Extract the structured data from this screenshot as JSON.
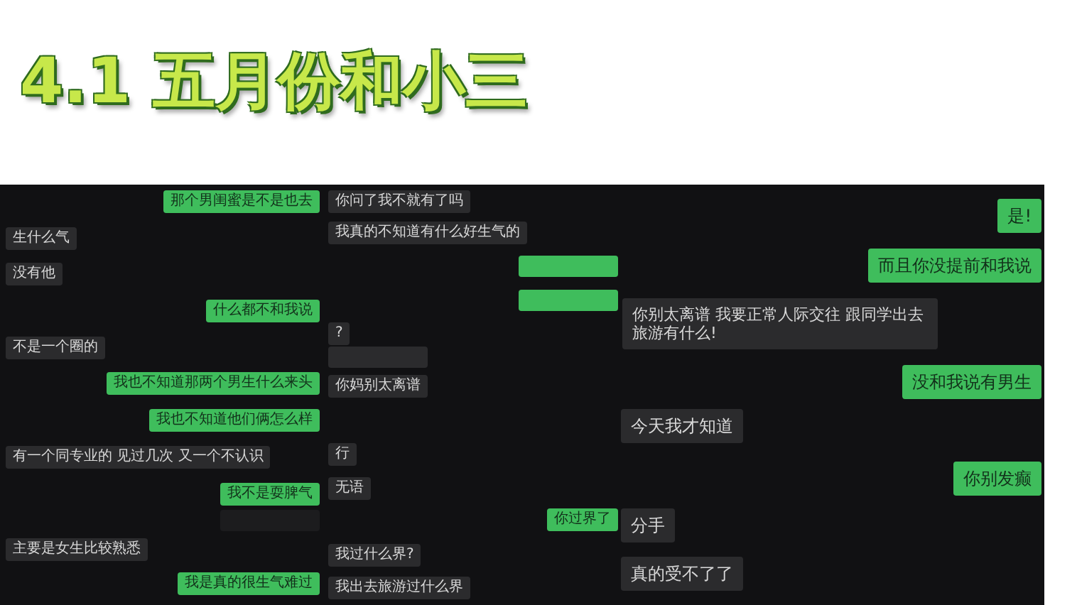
{
  "title": "4.1 五月份和小三",
  "messages": [
    {
      "outgoing": false,
      "kind": "text",
      "text": "生什么气"
    },
    {
      "outgoing": false,
      "kind": "text",
      "text": "没有他"
    },
    {
      "outgoing": false,
      "kind": "text",
      "text": "不是一个圈的"
    },
    {
      "outgoing": false,
      "kind": "text",
      "text": "有一个同专业的 见过几次 又一个不认识"
    },
    {
      "outgoing": false,
      "kind": "text",
      "text": "主要是女生比较熟悉"
    },
    {
      "outgoing": true,
      "kind": "text",
      "text": "那个男闺蜜是不是也去"
    },
    {
      "outgoing": true,
      "kind": "text",
      "text": "什么都不和我说"
    },
    {
      "outgoing": true,
      "kind": "text",
      "text": "我也不知道那两个男生什么来头"
    },
    {
      "outgoing": true,
      "kind": "text",
      "text": "我也不知道他们俩怎么样"
    },
    {
      "outgoing": true,
      "kind": "text",
      "text": "我不是耍脾气"
    },
    {
      "kind": "placeholder"
    },
    {
      "outgoing": true,
      "kind": "text",
      "text": "我是真的很生气难过"
    },
    {
      "outgoing": false,
      "kind": "text",
      "text": "你问了我不就有了吗"
    },
    {
      "outgoing": false,
      "kind": "text",
      "text": "我真的不知道有什么好生气的"
    },
    {
      "outgoing": false,
      "kind": "text",
      "text": "?"
    },
    {
      "outgoing": false,
      "kind": "blurred"
    },
    {
      "outgoing": false,
      "kind": "text",
      "text": "你妈别太离谱"
    },
    {
      "outgoing": false,
      "kind": "text",
      "text": "行"
    },
    {
      "outgoing": false,
      "kind": "text",
      "text": "无语"
    },
    {
      "outgoing": false,
      "kind": "text",
      "text": "我过什么界?"
    },
    {
      "outgoing": false,
      "kind": "text",
      "text": "我出去旅游过什么界"
    },
    {
      "outgoing": true,
      "kind": "blurred"
    },
    {
      "outgoing": true,
      "kind": "blurred"
    },
    {
      "outgoing": false,
      "kind": "large",
      "text": "你别太离谱 我要正常人际交往 跟同学出去旅游有什么!"
    },
    {
      "outgoing": false,
      "kind": "large",
      "text": "今天我才知道"
    },
    {
      "outgoing": true,
      "kind": "text",
      "text": "你过界了"
    },
    {
      "outgoing": false,
      "kind": "large",
      "text": "分手"
    },
    {
      "outgoing": false,
      "kind": "large",
      "text": "真的受不了了"
    },
    {
      "outgoing": true,
      "kind": "large",
      "text": "是!"
    },
    {
      "outgoing": true,
      "kind": "large",
      "text": "而且你没提前和我说"
    },
    {
      "outgoing": true,
      "kind": "large",
      "text": "没和我说有男生"
    },
    {
      "outgoing": true,
      "kind": "large",
      "text": "你别发癫"
    }
  ]
}
